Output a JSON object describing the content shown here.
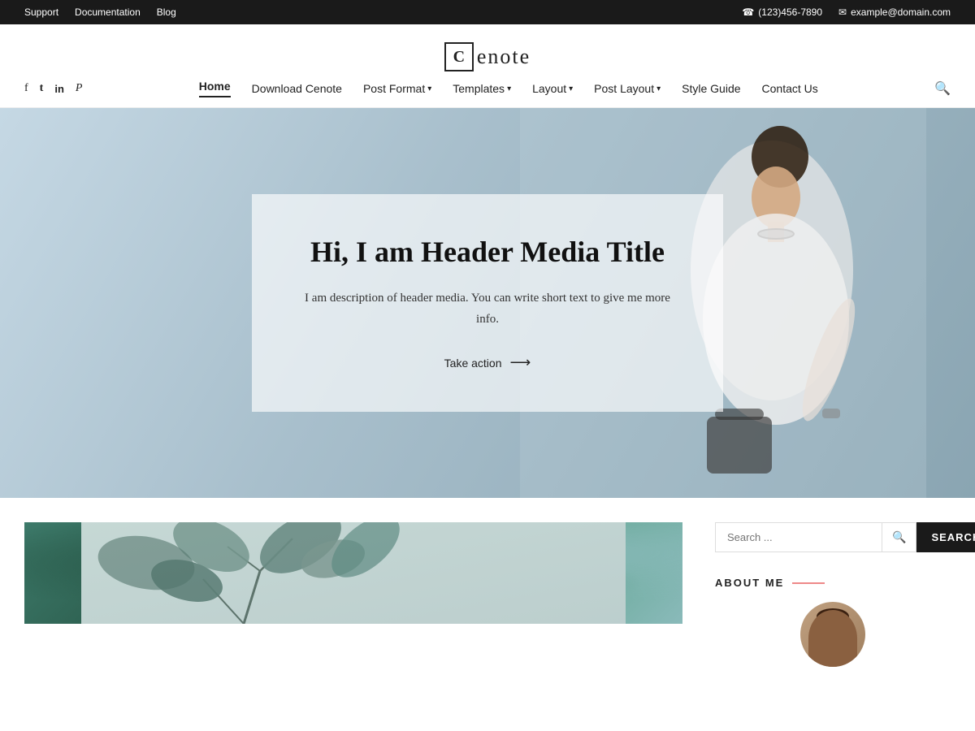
{
  "topbar": {
    "links": [
      "Support",
      "Documentation",
      "Blog"
    ],
    "phone": "(123)456-7890",
    "email": "example@domain.com"
  },
  "logo": {
    "letter": "C",
    "text": "enote"
  },
  "social": {
    "icons": [
      {
        "name": "facebook",
        "symbol": "f"
      },
      {
        "name": "twitter",
        "symbol": "𝕏"
      },
      {
        "name": "linkedin",
        "symbol": "in"
      },
      {
        "name": "pinterest",
        "symbol": "𝓟"
      }
    ]
  },
  "nav": {
    "items": [
      {
        "label": "Home",
        "active": true,
        "has_dropdown": false
      },
      {
        "label": "Download Cenote",
        "active": false,
        "has_dropdown": false
      },
      {
        "label": "Post Format",
        "active": false,
        "has_dropdown": true
      },
      {
        "label": "Templates",
        "active": false,
        "has_dropdown": true
      },
      {
        "label": "Layout",
        "active": false,
        "has_dropdown": true
      },
      {
        "label": "Post Layout",
        "active": false,
        "has_dropdown": true
      },
      {
        "label": "Style Guide",
        "active": false,
        "has_dropdown": false
      },
      {
        "label": "Contact Us",
        "active": false,
        "has_dropdown": false
      }
    ]
  },
  "hero": {
    "title": "Hi, I am Header Media Title",
    "description": "I am description of header media. You can write short text to give me more info.",
    "cta_label": "Take action",
    "cta_arrow": "⟶"
  },
  "search_widget": {
    "placeholder": "Search ...",
    "button_label": "SEARCH"
  },
  "sidebar": {
    "about_me_label": "ABOUT ME"
  }
}
